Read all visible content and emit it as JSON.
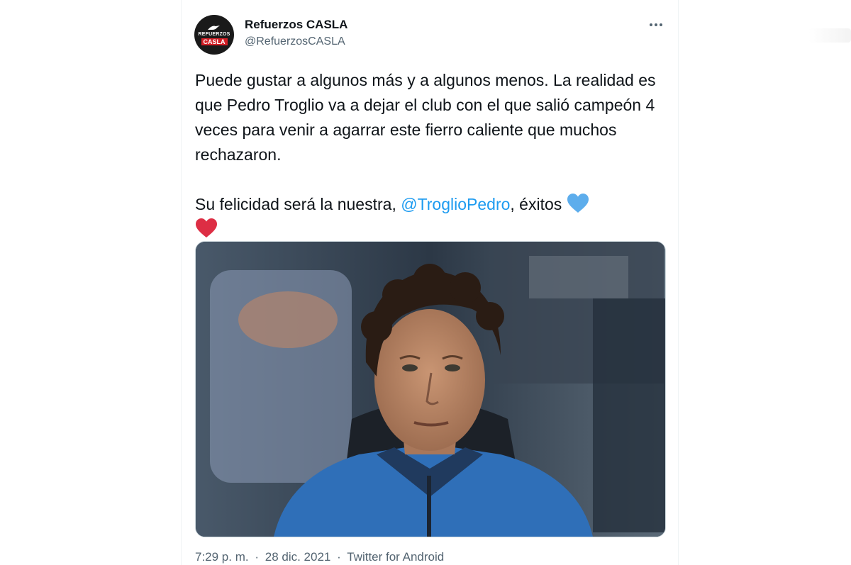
{
  "tweet": {
    "display_name": "Refuerzos CASLA",
    "handle": "@RefuerzosCASLA",
    "avatar": {
      "logo_line1": "REFUERZOS",
      "logo_line2": "CASLA",
      "accent": "#d41f26"
    },
    "more_icon": "more-horizontal-icon",
    "paragraph1": "Puede gustar a algunos más y a algunos menos. La realidad es que Pedro Troglio va a dejar el club con el que salió campeón 4 veces para venir a agarrar este fierro caliente que muchos rechazaron.",
    "paragraph2_prefix": "Su felicidad será la nuestra, ",
    "mention": "@TroglioPedro",
    "paragraph2_suffix": ", éxitos ",
    "emoji_1": "blue-heart-icon",
    "emoji_2": "red-heart-icon",
    "media_description_icon": "photo-of-man-in-blue-jacket",
    "time": "7:29 p. m.",
    "date": "28 dic. 2021",
    "source": "Twitter for Android",
    "separator": "·"
  },
  "colors": {
    "text": "#0f1419",
    "secondary": "#536471",
    "link": "#1d9bf0",
    "blue_heart": "#5dadec",
    "red_heart": "#dd2e44"
  }
}
